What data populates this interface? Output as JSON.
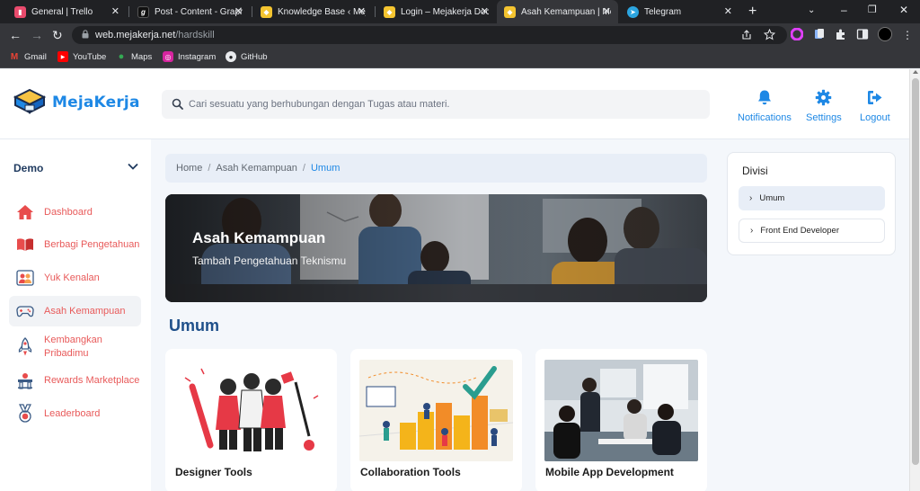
{
  "browser": {
    "tabs": [
      {
        "title": "General | Trello",
        "icon": "trello-icon",
        "color": "#e94b6d"
      },
      {
        "title": "Post - Content - Graph",
        "icon": "graph-icon",
        "color": "#101010"
      },
      {
        "title": "Knowledge Base ‹ Meja",
        "icon": "mejakerja-icon",
        "color": "#f4c430"
      },
      {
        "title": "Login – Mejakerja Docs",
        "icon": "mejakerja-icon",
        "color": "#f4c430"
      },
      {
        "title": "Asah Kemampuan | Me",
        "icon": "mejakerja-icon",
        "color": "#f4c430"
      },
      {
        "title": "Telegram",
        "icon": "telegram-icon",
        "color": "#2ca5e0"
      }
    ],
    "url_host": "web.mejakerja.net",
    "url_path": "/hardskill",
    "bookmarks": [
      {
        "label": "Gmail",
        "icon": "gmail-icon"
      },
      {
        "label": "YouTube",
        "icon": "youtube-icon"
      },
      {
        "label": "Maps",
        "icon": "maps-icon"
      },
      {
        "label": "Instagram",
        "icon": "instagram-icon"
      },
      {
        "label": "GitHub",
        "icon": "github-icon"
      }
    ]
  },
  "header": {
    "brand": "MejaKerja",
    "search_placeholder": "Cari sesuatu yang berhubungan dengan Tugas atau materi.",
    "actions": [
      {
        "label": "Notifications",
        "icon": "bell-icon"
      },
      {
        "label": "Settings",
        "icon": "gear-icon"
      },
      {
        "label": "Logout",
        "icon": "logout-icon"
      }
    ],
    "accent": "#1e88e5"
  },
  "sidebar": {
    "workspace": "Demo",
    "items": [
      {
        "label": "Dashboard",
        "icon": "home-icon"
      },
      {
        "label": "Berbagi Pengetahuan",
        "icon": "book-icon"
      },
      {
        "label": "Yuk Kenalan",
        "icon": "people-icon"
      },
      {
        "label": "Asah Kemampuan",
        "icon": "gamepad-icon",
        "active": true
      },
      {
        "label": "Kembangkan Pribadimu",
        "icon": "rocket-icon"
      },
      {
        "label": "Rewards Marketplace",
        "icon": "rewards-icon"
      },
      {
        "label": "Leaderboard",
        "icon": "medal-icon"
      }
    ],
    "item_color": "#e85a5a"
  },
  "main": {
    "breadcrumb": [
      "Home",
      "Asah Kemampuan",
      "Umum"
    ],
    "hero": {
      "title": "Asah Kemampuan",
      "subtitle": "Tambah Pengetahuan Teknismu"
    },
    "section_title": "Umum",
    "cards": [
      {
        "title": "Designer Tools"
      },
      {
        "title": "Collaboration Tools"
      },
      {
        "title": "Mobile App Development"
      }
    ]
  },
  "divisi": {
    "title": "Divisi",
    "items": [
      {
        "label": "Umum",
        "active": true
      },
      {
        "label": "Front End Developer",
        "active": false
      }
    ]
  }
}
